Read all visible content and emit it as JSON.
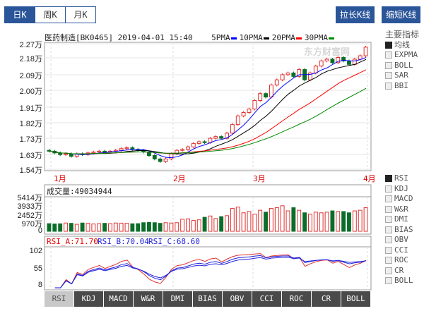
{
  "period_tabs": [
    "日K",
    "周K",
    "月K"
  ],
  "active_period": 0,
  "buttons": {
    "stretch": "拉长K线",
    "shrink": "缩短K线"
  },
  "header": {
    "title": "医药制造[BK0465] 2019-04-01 15:40",
    "ma": [
      {
        "label": "5PMA",
        "color": "#0000ff"
      },
      {
        "label": "10PMA",
        "color": "#000000"
      },
      {
        "label": "20PMA",
        "color": "#ff0000"
      },
      {
        "label": "30PMA",
        "color": "#008800"
      }
    ]
  },
  "watermark": "东方财富网",
  "price_axis": [
    "2.27万",
    "2.18万",
    "2.09万",
    "2.00万",
    "1.91万",
    "1.82万",
    "1.73万",
    "1.63万",
    "1.54万"
  ],
  "months": [
    "1月",
    "2月",
    "3月",
    "4月"
  ],
  "volume": {
    "label": "成交量:49034944",
    "axis": [
      "5414万",
      "3933万",
      "2452万",
      "970万",
      "0"
    ]
  },
  "rsi": {
    "a": "RSI_A:71.70",
    "b": "RSI_B:70.04",
    "c": "RSI_C:68.60",
    "axis": [
      "102",
      "55",
      "8"
    ]
  },
  "main_indicators": {
    "title": "主要指标",
    "items": [
      {
        "label": "均线",
        "on": true
      },
      {
        "label": "EXPMA"
      },
      {
        "label": "BOLL"
      },
      {
        "label": "SAR"
      },
      {
        "label": "BBI"
      }
    ]
  },
  "sub_indicators": [
    {
      "label": "RSI",
      "on": true
    },
    {
      "label": "KDJ"
    },
    {
      "label": "MACD"
    },
    {
      "label": "W&R"
    },
    {
      "label": "DMI"
    },
    {
      "label": "BIAS"
    },
    {
      "label": "OBV"
    },
    {
      "label": "CCI"
    },
    {
      "label": "ROC"
    },
    {
      "label": "CR"
    },
    {
      "label": "BOLL"
    }
  ],
  "indicator_tabs": [
    "RSI",
    "KDJ",
    "MACD",
    "W&R",
    "DMI",
    "BIAS",
    "OBV",
    "CCI",
    "ROC",
    "CR",
    "BOLL"
  ],
  "colors": {
    "up": "#e03030",
    "down": "#0a6e2a",
    "accent": "#2a5599"
  },
  "chart_data": {
    "type": "candlestick",
    "unit": "万",
    "ylim": [
      1.54,
      2.27
    ],
    "close": [
      1.645,
      1.635,
      1.625,
      1.63,
      1.615,
      1.63,
      1.625,
      1.635,
      1.64,
      1.645,
      1.64,
      1.645,
      1.65,
      1.66,
      1.665,
      1.655,
      1.65,
      1.64,
      1.62,
      1.6,
      1.585,
      1.6,
      1.63,
      1.65,
      1.655,
      1.67,
      1.69,
      1.7,
      1.695,
      1.72,
      1.73,
      1.72,
      1.75,
      1.8,
      1.85,
      1.87,
      1.89,
      1.94,
      1.98,
      1.96,
      2.03,
      2.06,
      2.09,
      2.1,
      2.08,
      2.12,
      2.06,
      2.1,
      2.14,
      2.17,
      2.18,
      2.16,
      2.19,
      2.17,
      2.15,
      2.18,
      2.2,
      2.25
    ],
    "volume_wan": [
      1200,
      1150,
      1180,
      1300,
      1250,
      1100,
      1300,
      1250,
      1150,
      1200,
      1250,
      1200,
      1300,
      1280,
      1250,
      1180,
      1200,
      1350,
      1400,
      1350,
      1250,
      1350,
      1300,
      1350,
      1900,
      1950,
      1700,
      1800,
      2200,
      2400,
      2000,
      2300,
      2450,
      3600,
      3800,
      2900,
      3100,
      2700,
      3300,
      3000,
      3600,
      3700,
      4000,
      3200,
      3700,
      3300,
      2900,
      2700,
      3000,
      2900,
      3000,
      3200,
      3100,
      3100,
      2900,
      3200,
      3300,
      3700
    ]
  }
}
